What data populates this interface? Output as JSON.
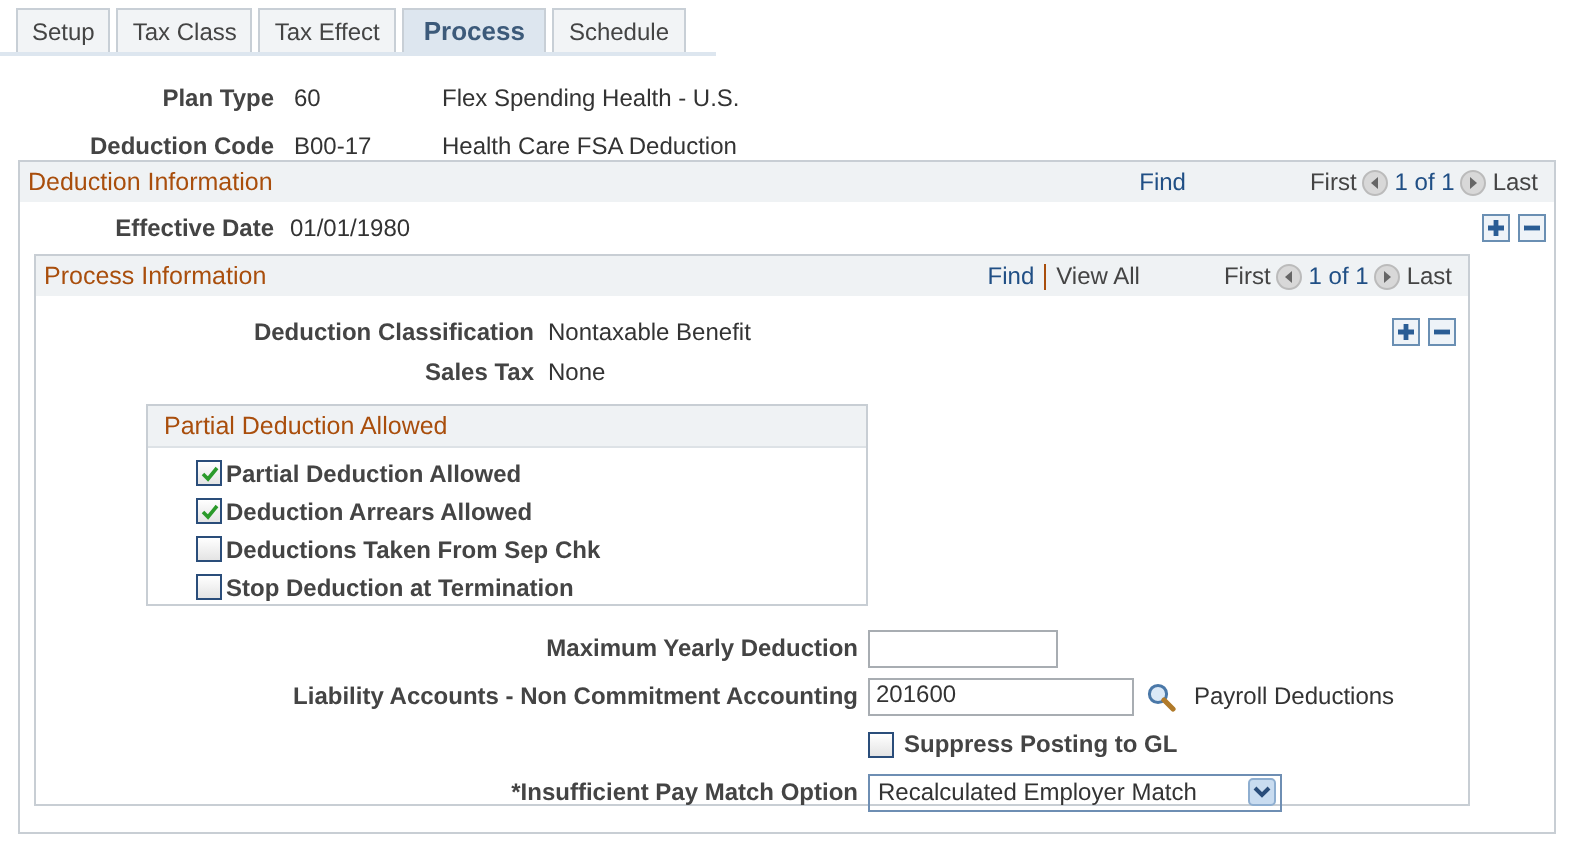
{
  "tabs": [
    {
      "label": "Setup",
      "selected": false
    },
    {
      "label": "Tax Class",
      "selected": false
    },
    {
      "label": "Tax Effect",
      "selected": false
    },
    {
      "label": "Process",
      "selected": true
    },
    {
      "label": "Schedule",
      "selected": false
    }
  ],
  "header_fields": [
    {
      "label": "Plan Type",
      "value": "60",
      "description": "Flex Spending Health - U.S."
    },
    {
      "label": "Deduction Code",
      "value": "B00-17",
      "description": "Health Care FSA Deduction"
    }
  ],
  "deduction_information": {
    "title": "Deduction Information",
    "find": "Find",
    "nav": {
      "first": "First",
      "count": "1 of 1",
      "last": "Last"
    },
    "effective_date": {
      "label": "Effective Date",
      "value": "01/01/1980"
    },
    "process_information": {
      "title": "Process Information",
      "find": "Find",
      "view_all": "View All",
      "nav": {
        "first": "First",
        "count": "1 of 1",
        "last": "Last"
      },
      "fields": [
        {
          "label": "Deduction Classification",
          "value": "Nontaxable Benefit"
        },
        {
          "label": "Sales Tax",
          "value": "None"
        }
      ],
      "partial_deduction": {
        "title": "Partial Deduction Allowed",
        "options": [
          {
            "label": "Partial Deduction Allowed",
            "checked": true
          },
          {
            "label": "Deduction Arrears Allowed",
            "checked": true
          },
          {
            "label": "Deductions Taken From Sep Chk",
            "checked": false
          },
          {
            "label": "Stop Deduction at Termination",
            "checked": false
          }
        ]
      },
      "max_yearly": {
        "label": "Maximum Yearly Deduction"
      },
      "liability": {
        "label": "Liability Accounts - Non Commitment Accounting",
        "value": "201600",
        "description": "Payroll Deductions"
      },
      "suppress": {
        "label": "Suppress Posting to GL",
        "checked": false
      },
      "insufficient": {
        "label": "*Insufficient Pay Match Option",
        "value": "Recalculated Employer Match"
      }
    }
  }
}
